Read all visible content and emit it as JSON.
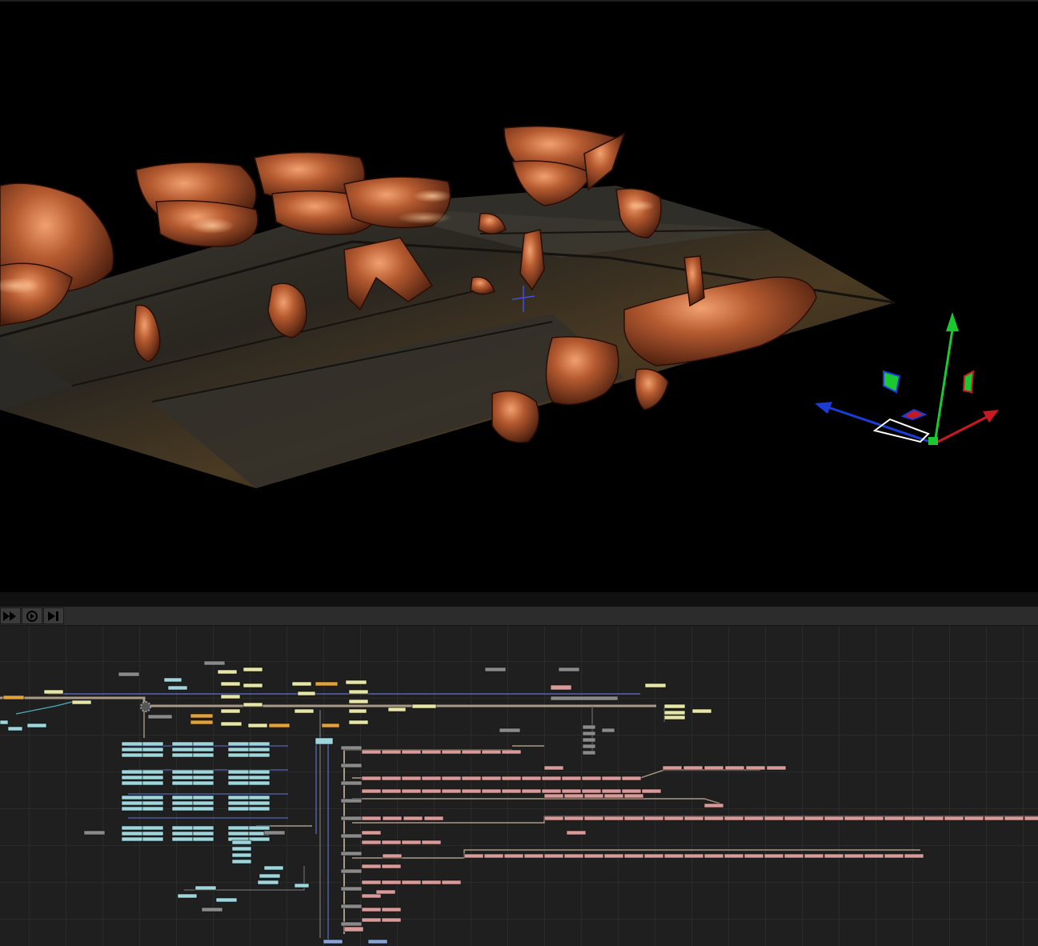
{
  "toolbar": {
    "buttons": [
      {
        "name": "fast-forward-button",
        "icon": "fast-forward-icon"
      },
      {
        "name": "play-toggle-button",
        "icon": "play-circle-icon"
      },
      {
        "name": "step-end-button",
        "icon": "skip-end-icon"
      }
    ]
  },
  "viewport": {
    "background": "#000000",
    "gizmo_colors": {
      "x_axis": "#c81820",
      "y_axis": "#1cc832",
      "z_axis": "#1c3cd8"
    }
  },
  "graph": {
    "background": "#1f1f1f",
    "grid_color": "#2b2b2b",
    "node_colors": {
      "cyan": "#9fd6dc",
      "yellow": "#e6e6a8",
      "orange": "#e2a23a",
      "pink": "#d99a9a",
      "gray": "#8a8a8a",
      "blue": "#8aa4d6"
    },
    "wire_colors": {
      "tan": "#a89a86",
      "blue": "#5664b4",
      "cyan": "#4fb0c0",
      "gray": "#6a6a6a"
    }
  }
}
